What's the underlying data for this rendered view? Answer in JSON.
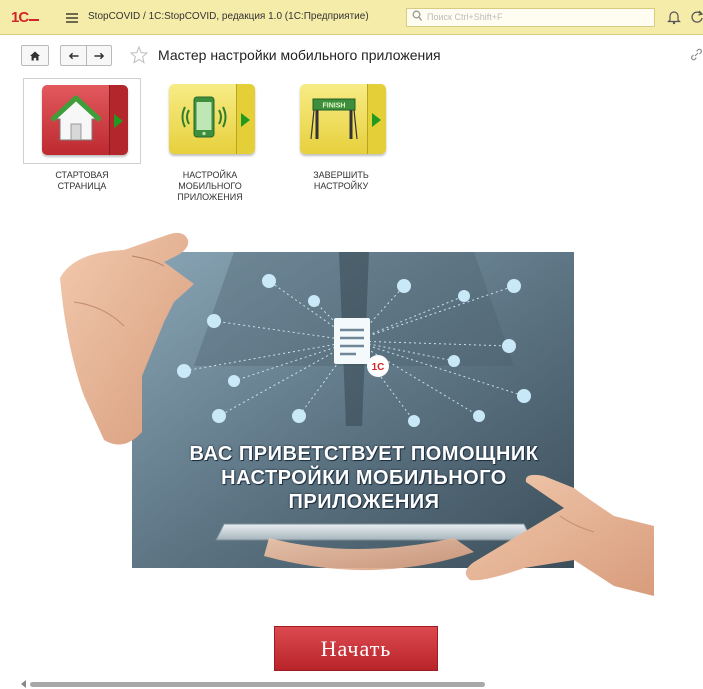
{
  "titlebar": {
    "logo": "1C",
    "app_title": "StopCOVID / 1C:StopCOVID, редакция 1.0  (1С:Предприятие)",
    "search_placeholder": "Поиск Ctrl+Shift+F"
  },
  "toolbar": {
    "page_title": "Мастер настройки мобильного приложения"
  },
  "steps": [
    {
      "label_line1": "СТАРТОВАЯ",
      "label_line2": "СТРАНИЦА",
      "label_line3": "",
      "icon": "home-icon",
      "active": true
    },
    {
      "label_line1": "НАСТРОЙКА",
      "label_line2": "МОБИЛЬНОГО",
      "label_line3": "ПРИЛОЖЕНИЯ",
      "icon": "phone-icon",
      "active": false
    },
    {
      "label_line1": "ЗАВЕРШИТЬ",
      "label_line2": "НАСТРОЙКУ",
      "label_line3": "",
      "icon": "finish-gate-icon",
      "active": false
    }
  ],
  "finish_sign": "FINISH",
  "hero": {
    "line1": "ВАС ПРИВЕТСТВУЕТ ПОМОЩНИК",
    "line2": "НАСТРОЙКИ МОБИЛЬНОГО",
    "line3": "ПРИЛОЖЕНИЯ",
    "badge": "1С"
  },
  "start_button": "Начать",
  "colors": {
    "titlebar_bg": "#f6ecaa",
    "accent_red": "#c8323a",
    "tile_yellow": "#eedb55",
    "arrow_green": "#1e9a1e"
  }
}
